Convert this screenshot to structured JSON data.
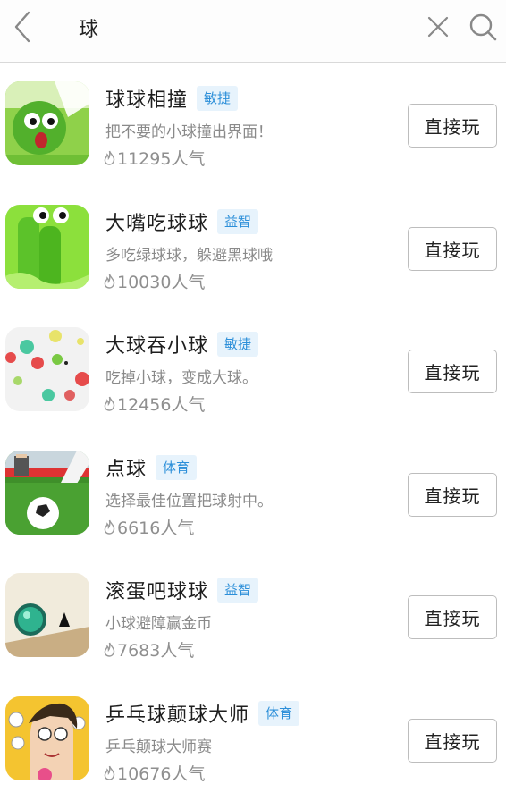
{
  "search": {
    "query": "球",
    "back_icon": "chevron-left-icon",
    "clear_icon": "close-icon",
    "search_icon": "search-icon"
  },
  "games": [
    {
      "title": "球球相撞",
      "tag": "敏捷",
      "description": "把不要的小球撞出界面！",
      "popularity": "11295人气",
      "button": "直接玩"
    },
    {
      "title": "大嘴吃球球",
      "tag": "益智",
      "description": "多吃绿球球，躲避黑球哦",
      "popularity": "10030人气",
      "button": "直接玩"
    },
    {
      "title": "大球吞小球",
      "tag": "敏捷",
      "description": "吃掉小球，变成大球。",
      "popularity": "12456人气",
      "button": "直接玩"
    },
    {
      "title": "点球",
      "tag": "体育",
      "description": "选择最佳位置把球射中。",
      "popularity": "6616人气",
      "button": "直接玩"
    },
    {
      "title": "滚蛋吧球球",
      "tag": "益智",
      "description": "小球避障赢金币",
      "popularity": "7683人气",
      "button": "直接玩"
    },
    {
      "title": "乒乓球颠球大师",
      "tag": "体育",
      "description": "乒乓颠球大师赛",
      "popularity": "10676人气",
      "button": "直接玩"
    }
  ],
  "colors": {
    "tag_text": "#2c8fd9",
    "tag_bg": "#e7f3fc",
    "secondary_text": "#8a8a8a",
    "button_border": "#bdbdbd"
  }
}
